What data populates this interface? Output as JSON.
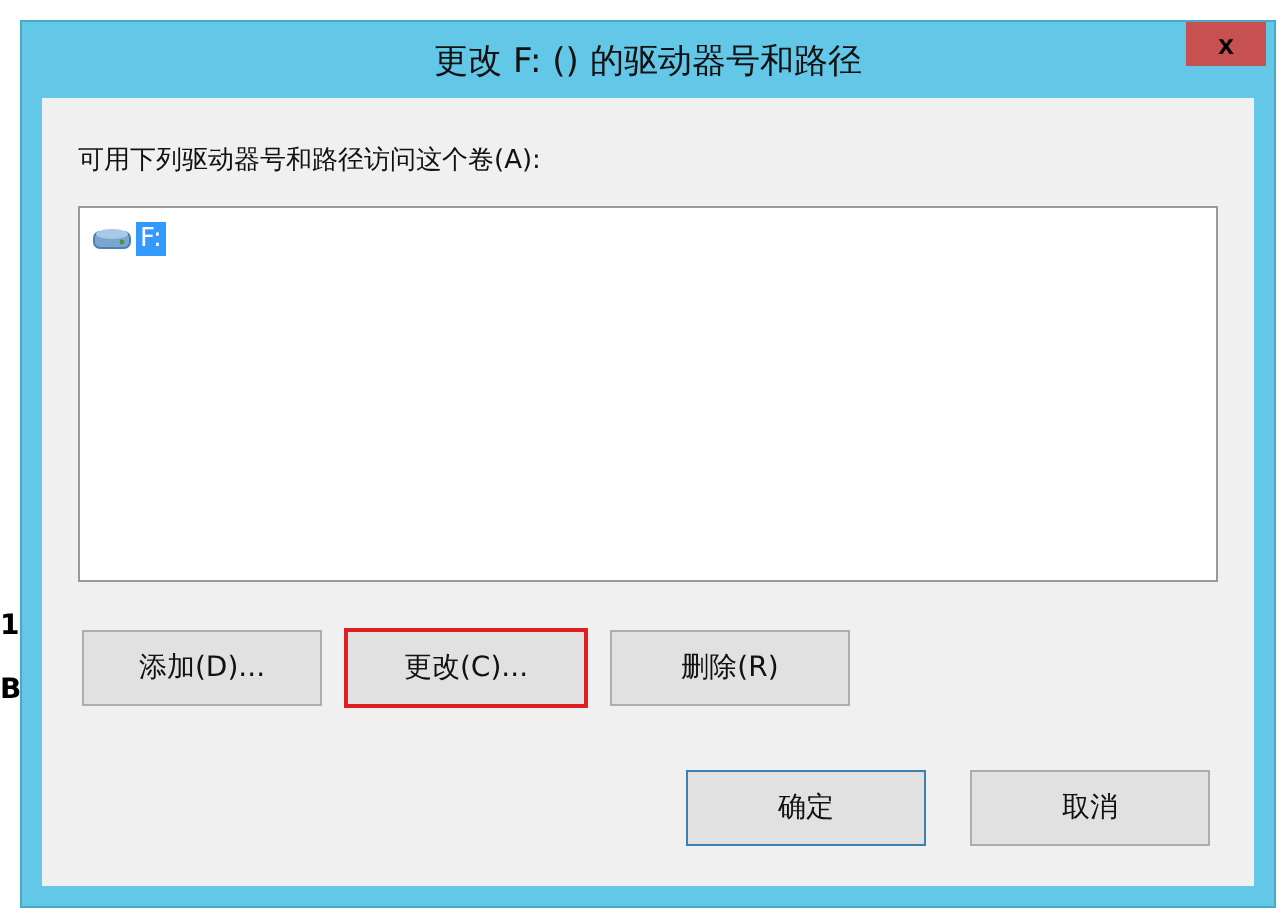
{
  "background": {
    "fragments": [
      "1",
      "B"
    ]
  },
  "dialog": {
    "title": "更改 F: () 的驱动器号和路径",
    "close": "x",
    "label": "可用下列驱动器号和路径访问这个卷(A):",
    "list_items": [
      {
        "text": "F:",
        "selected": true
      }
    ],
    "action_buttons": [
      {
        "label": "添加(D)...",
        "highlighted": false
      },
      {
        "label": "更改(C)...",
        "highlighted": true
      },
      {
        "label": "删除(R)",
        "highlighted": false
      }
    ],
    "dialog_buttons": [
      {
        "label": "确定",
        "default": true
      },
      {
        "label": "取消",
        "default": false
      }
    ]
  }
}
